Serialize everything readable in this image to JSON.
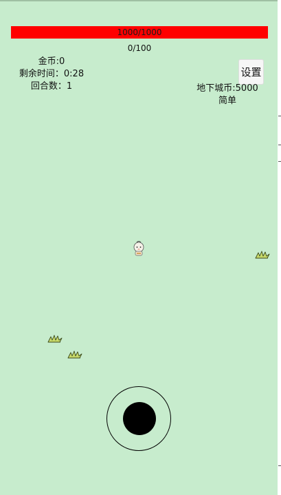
{
  "hud": {
    "hp_text": "1000/1000",
    "hp_fraction": 1.0,
    "exp_text": "0/100",
    "gold": "金币:0",
    "time_left": "剩余时间：0:28",
    "round": "回合数：1",
    "settings_label": "设置",
    "dungeon_coins": "地下城币:5000",
    "difficulty": "简单"
  },
  "colors": {
    "background": "#c7eccd",
    "hp_bar": "#ff0000"
  },
  "sprites": [
    "player-character",
    "grass-enemy",
    "grass-enemy",
    "grass-enemy"
  ]
}
